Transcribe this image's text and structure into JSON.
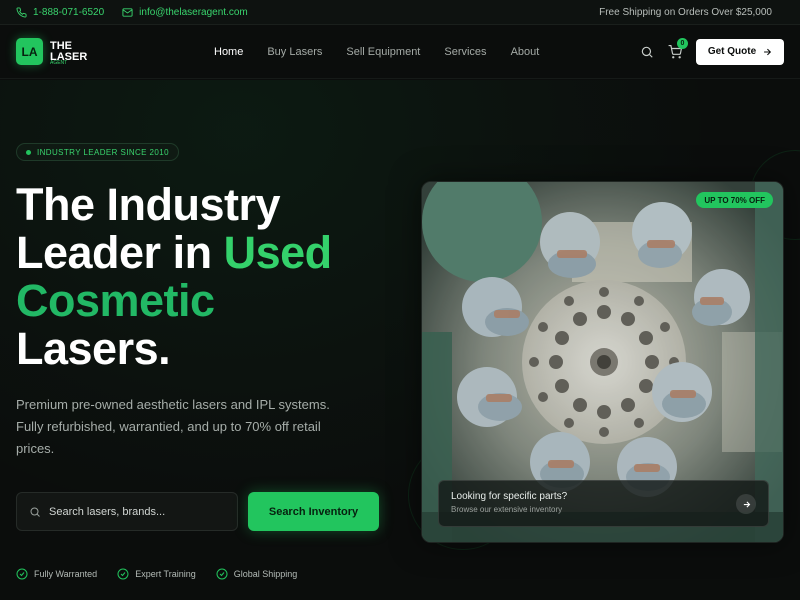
{
  "topbar": {
    "phone": "1-888-071-6520",
    "email": "info@thelaseragent.com",
    "shipping": "Free Shipping on Orders Over $25,000"
  },
  "logo": {
    "badge": "LA",
    "line1": "THE",
    "line2": "LASER",
    "tagline": "AGENT"
  },
  "nav": {
    "items": [
      {
        "label": "Home",
        "active": true
      },
      {
        "label": "Buy Lasers"
      },
      {
        "label": "Sell Equipment"
      },
      {
        "label": "Services"
      },
      {
        "label": "About"
      }
    ],
    "cart_count": "0",
    "cta": "Get Quote"
  },
  "hero": {
    "pill": "INDUSTRY LEADER SINCE 2010",
    "headline_1": "The Industry",
    "headline_2a": "Leader in ",
    "headline_2b": "Used",
    "headline_3": "Cosmetic",
    "headline_4": "Lasers.",
    "subcopy": "Premium pre-owned aesthetic lasers and IPL systems. Fully refurbished, warrantied, and up to 70% off retail prices.",
    "search_placeholder": "Search lasers, brands...",
    "search_button": "Search Inventory",
    "features": [
      "Fully Warranted",
      "Expert Training",
      "Global Shipping"
    ]
  },
  "card": {
    "badge": "UP TO 70% OFF",
    "parts_title": "Looking for specific parts?",
    "parts_sub": "Browse our extensive inventory"
  },
  "colors": {
    "accent": "#22c55e",
    "background": "#0b0d0c"
  }
}
